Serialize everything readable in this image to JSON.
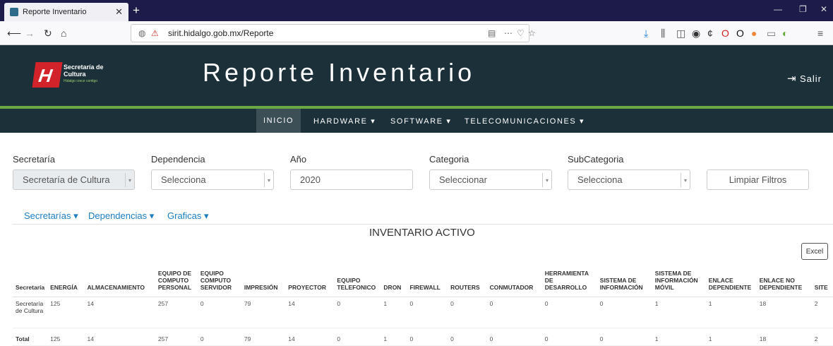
{
  "browser": {
    "tab_title": "Reporte Inventario",
    "url_text": "sirit.hidalgo.gob.mx/Reporte"
  },
  "header": {
    "org_line1": "Secretaría de",
    "org_line2": "Cultura",
    "org_tag": "Hidalgo crece contigo",
    "title": "Reporte Inventario",
    "logout": "Salir"
  },
  "menu": {
    "inicio": "INICIO",
    "hardware": "HARDWARE ▾",
    "software": "SOFTWARE ▾",
    "telecom": "TELECOMUNICACIONES ▾"
  },
  "filters": {
    "secretaria_label": "Secretaría",
    "secretaria_value": "Secretaría de Cultura",
    "dependencia_label": "Dependencia",
    "dependencia_value": "Selecciona",
    "anio_label": "Año",
    "anio_value": "2020",
    "categoria_label": "Categoria",
    "categoria_value": "Seleccionar",
    "subcategoria_label": "SubCategoria",
    "subcategoria_value": "Selecciona",
    "clear_label": "Limpiar Filtros"
  },
  "dropdowns": {
    "secretarias": "Secretarías ▾",
    "dependencias": "Dependencias ▾",
    "graficas": "Graficas ▾"
  },
  "section_title": "INVENTARIO ACTIVO",
  "excel_label": "Excel",
  "table": {
    "headers": [
      "Secretaría",
      "ENERGÍA",
      "ALMACENAMIENTO",
      "EQUIPO DE COMPUTO PERSONAL",
      "EQUIPO COMPUTO SERVIDOR",
      "IMPRESIÓN",
      "PROYECTOR",
      "EQUIPO TELEFONICO",
      "DRON",
      "FIREWALL",
      "ROUTERS",
      "CONMUTADOR",
      "HERRAMIENTA DE DESARROLLO",
      "SISTEMA DE INFORMACIÓN",
      "SISTEMA DE INFORMACIÓN MÓVIL",
      "ENLACE DEPENDIENTE",
      "ENLACE NO DEPENDIENTE",
      "SITE"
    ],
    "row1": [
      "Secretaría de Cultura",
      "125",
      "14",
      "257",
      "0",
      "79",
      "14",
      "0",
      "1",
      "0",
      "0",
      "0",
      "0",
      "0",
      "1",
      "1",
      "18",
      "2"
    ],
    "total": [
      "Total",
      "125",
      "14",
      "257",
      "0",
      "79",
      "14",
      "0",
      "1",
      "0",
      "0",
      "0",
      "0",
      "0",
      "1",
      "1",
      "18",
      "2"
    ]
  }
}
